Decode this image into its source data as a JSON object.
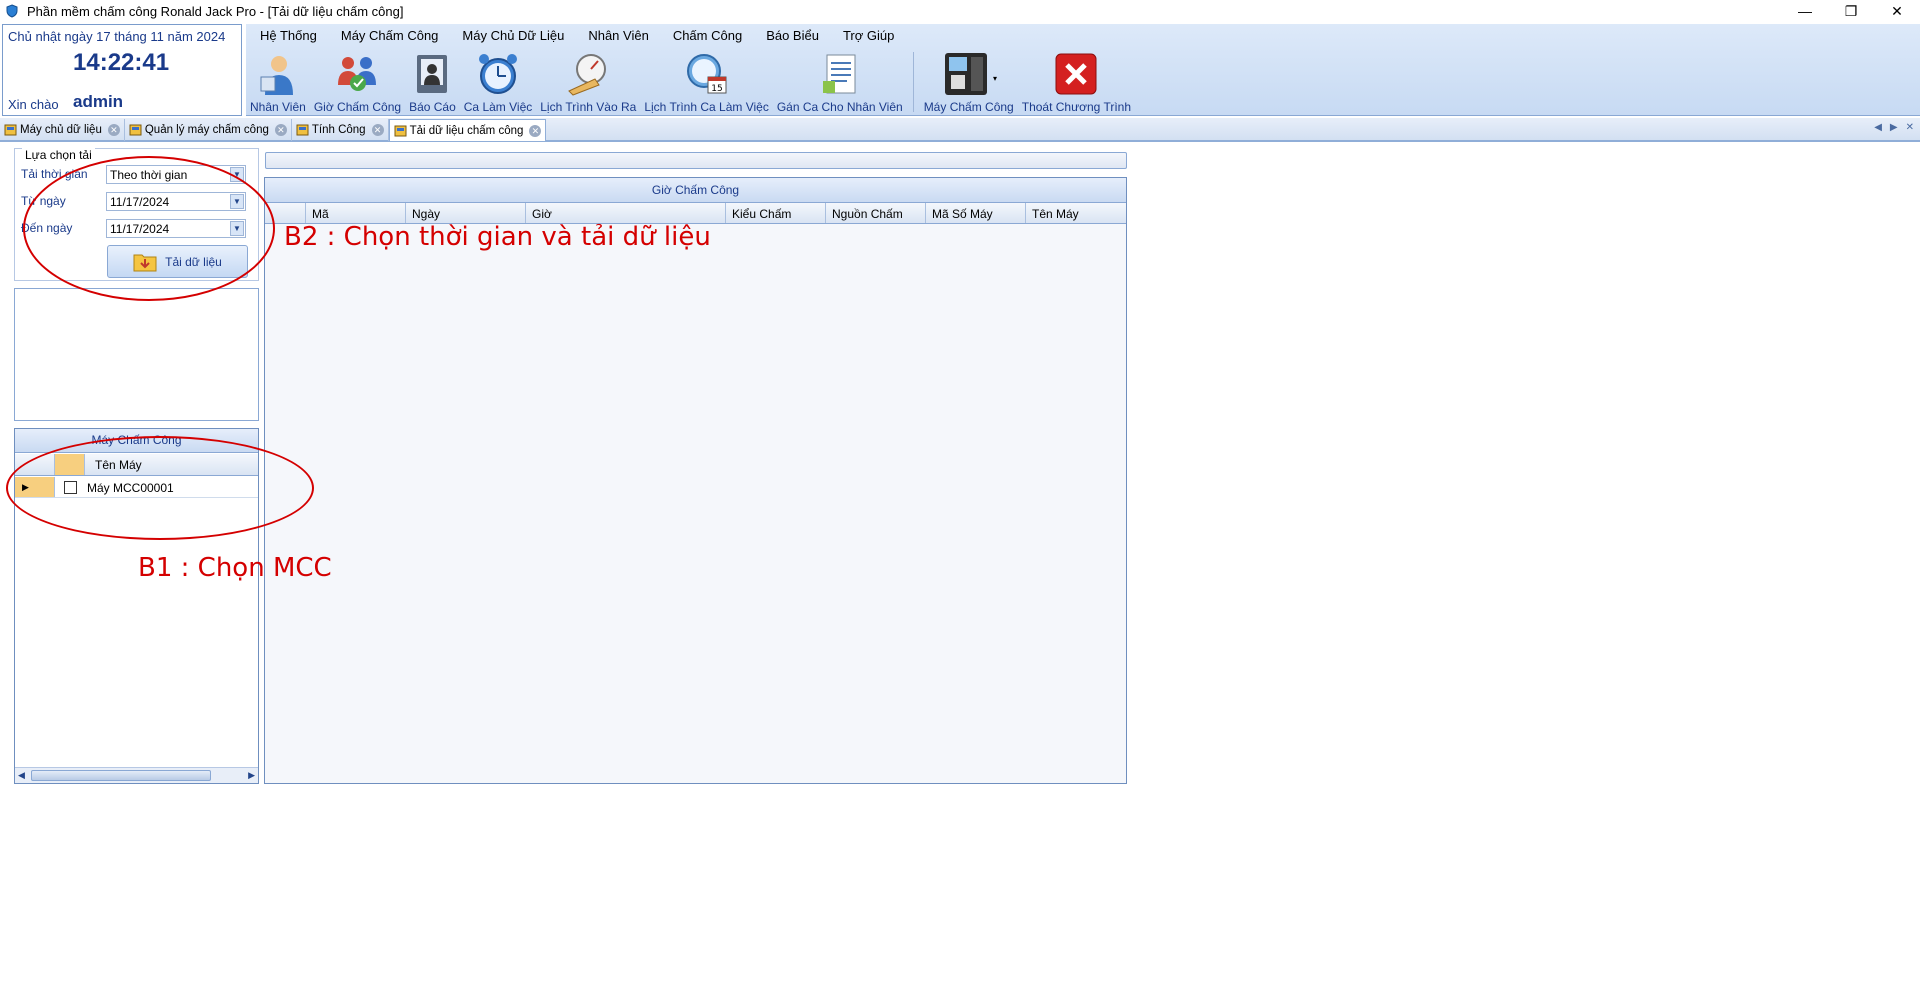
{
  "window": {
    "title": "Phần mềm chấm công Ronald Jack Pro - [Tải dữ liệu chấm công]",
    "minimize": "—",
    "restore": "❐",
    "close": "✕"
  },
  "clock": {
    "date": "Chủ nhật ngày 17 tháng 11 năm 2024",
    "time": "14:22:41",
    "greeting": "Xin chào",
    "username": "admin"
  },
  "menu": [
    "Hệ Thống",
    "Máy Chấm Công",
    "Máy Chủ Dữ Liệu",
    "Nhân Viên",
    "Chấm Công",
    "Báo Biểu",
    "Trợ Giúp"
  ],
  "toolbar": {
    "employees": "Nhân Viên",
    "attendance_time": "Giờ Chấm Công",
    "report": "Báo Cáo",
    "shift": "Ca Làm Việc",
    "schedule_inout": "Lịch Trình Vào Ra",
    "schedule_shift": "Lịch Trình Ca Làm Việc",
    "assign_shift": "Gán Ca Cho Nhân Viên",
    "machine": "Máy Chấm Công",
    "exit": "Thoát Chương Trình"
  },
  "tabs": [
    {
      "label": "Máy chủ dữ liệu",
      "active": false
    },
    {
      "label": "Quản lý máy chấm công",
      "active": false
    },
    {
      "label": "Tính Công",
      "active": false
    },
    {
      "label": "Tải dữ liệu chấm công",
      "active": true
    }
  ],
  "filter": {
    "legend": "Lựa chọn tải",
    "mode_label": "Tải thời gian",
    "mode_value": "Theo thời gian",
    "from_label": "Từ ngày",
    "from_value": "11/17/2024",
    "to_label": "Đến ngày",
    "to_value": "11/17/2024",
    "load_button": "Tải dữ liệu"
  },
  "machines": {
    "header": "Máy Chấm Công",
    "column": "Tên Máy",
    "rows": [
      {
        "name": "Máy MCC00001",
        "checked": false
      }
    ]
  },
  "attendance_grid": {
    "caption": "Giờ Chấm Công",
    "columns": [
      "Mã",
      "Ngày",
      "Giờ",
      "Kiểu Chấm",
      "Nguồn Chấm",
      "Mã Số Máy",
      "Tên Máy"
    ]
  },
  "annotations": {
    "step2": "B2 : Chọn thời gian và tải dữ liệu",
    "step1": "B1 : Chọn MCC"
  },
  "colors": {
    "annotation": "#d40000",
    "ribbon": "#c7daf3",
    "accent_text": "#1a3a8a"
  }
}
